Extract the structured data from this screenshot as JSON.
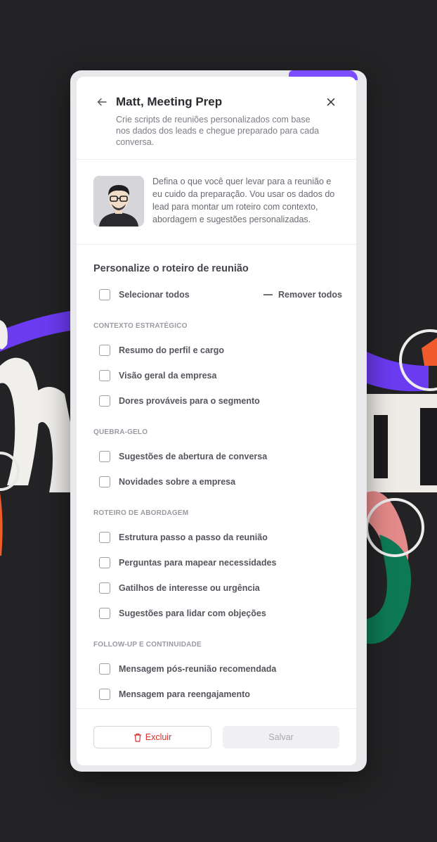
{
  "header": {
    "title": "Matt, Meeting Prep",
    "subtitle": "Crie scripts de reuniões personalizados com base nos dados dos leads e chegue preparado para cada conversa."
  },
  "intro": {
    "text": "Defina o que você quer levar para a reunião e eu cuido da preparação. Vou usar os dados do lead para montar um roteiro com contexto, abordagem e sugestões personalizadas."
  },
  "customize": {
    "title": "Personalize o roteiro de reunião",
    "select_all": "Selecionar todos",
    "remove_all": "Remover todos"
  },
  "groups": [
    {
      "label": "CONTEXTO ESTRATÉGICO",
      "items": [
        {
          "label": "Resumo do perfil e cargo",
          "checked": false
        },
        {
          "label": "Visão geral da empresa",
          "checked": false
        },
        {
          "label": "Dores prováveis para o segmento",
          "checked": false
        }
      ]
    },
    {
      "label": "QUEBRA-GELO",
      "items": [
        {
          "label": "Sugestões de abertura de conversa",
          "checked": false
        },
        {
          "label": "Novidades sobre a empresa",
          "checked": false
        }
      ]
    },
    {
      "label": "ROTEIRO DE ABORDAGEM",
      "items": [
        {
          "label": "Estrutura passo a passo da reunião",
          "checked": false
        },
        {
          "label": "Perguntas para mapear necessidades",
          "checked": false
        },
        {
          "label": "Gatilhos de interesse ou urgência",
          "checked": false
        },
        {
          "label": "Sugestões para lidar com objeções",
          "checked": false
        }
      ]
    },
    {
      "label": "FOLLOW-UP E CONTINUIDADE",
      "items": [
        {
          "label": "Mensagem pós-reunião recomendada",
          "checked": false
        },
        {
          "label": "Mensagem para reengajamento",
          "checked": false
        }
      ]
    }
  ],
  "footer": {
    "delete_label": "Excluir",
    "save_label": "Salvar"
  },
  "icons": {
    "back": "arrow-left-icon",
    "close": "close-icon",
    "delete": "trash-icon"
  },
  "colors": {
    "danger": "#d9302c",
    "accent_purple": "#7c4dff",
    "disabled_bg": "#f0f0f3"
  }
}
